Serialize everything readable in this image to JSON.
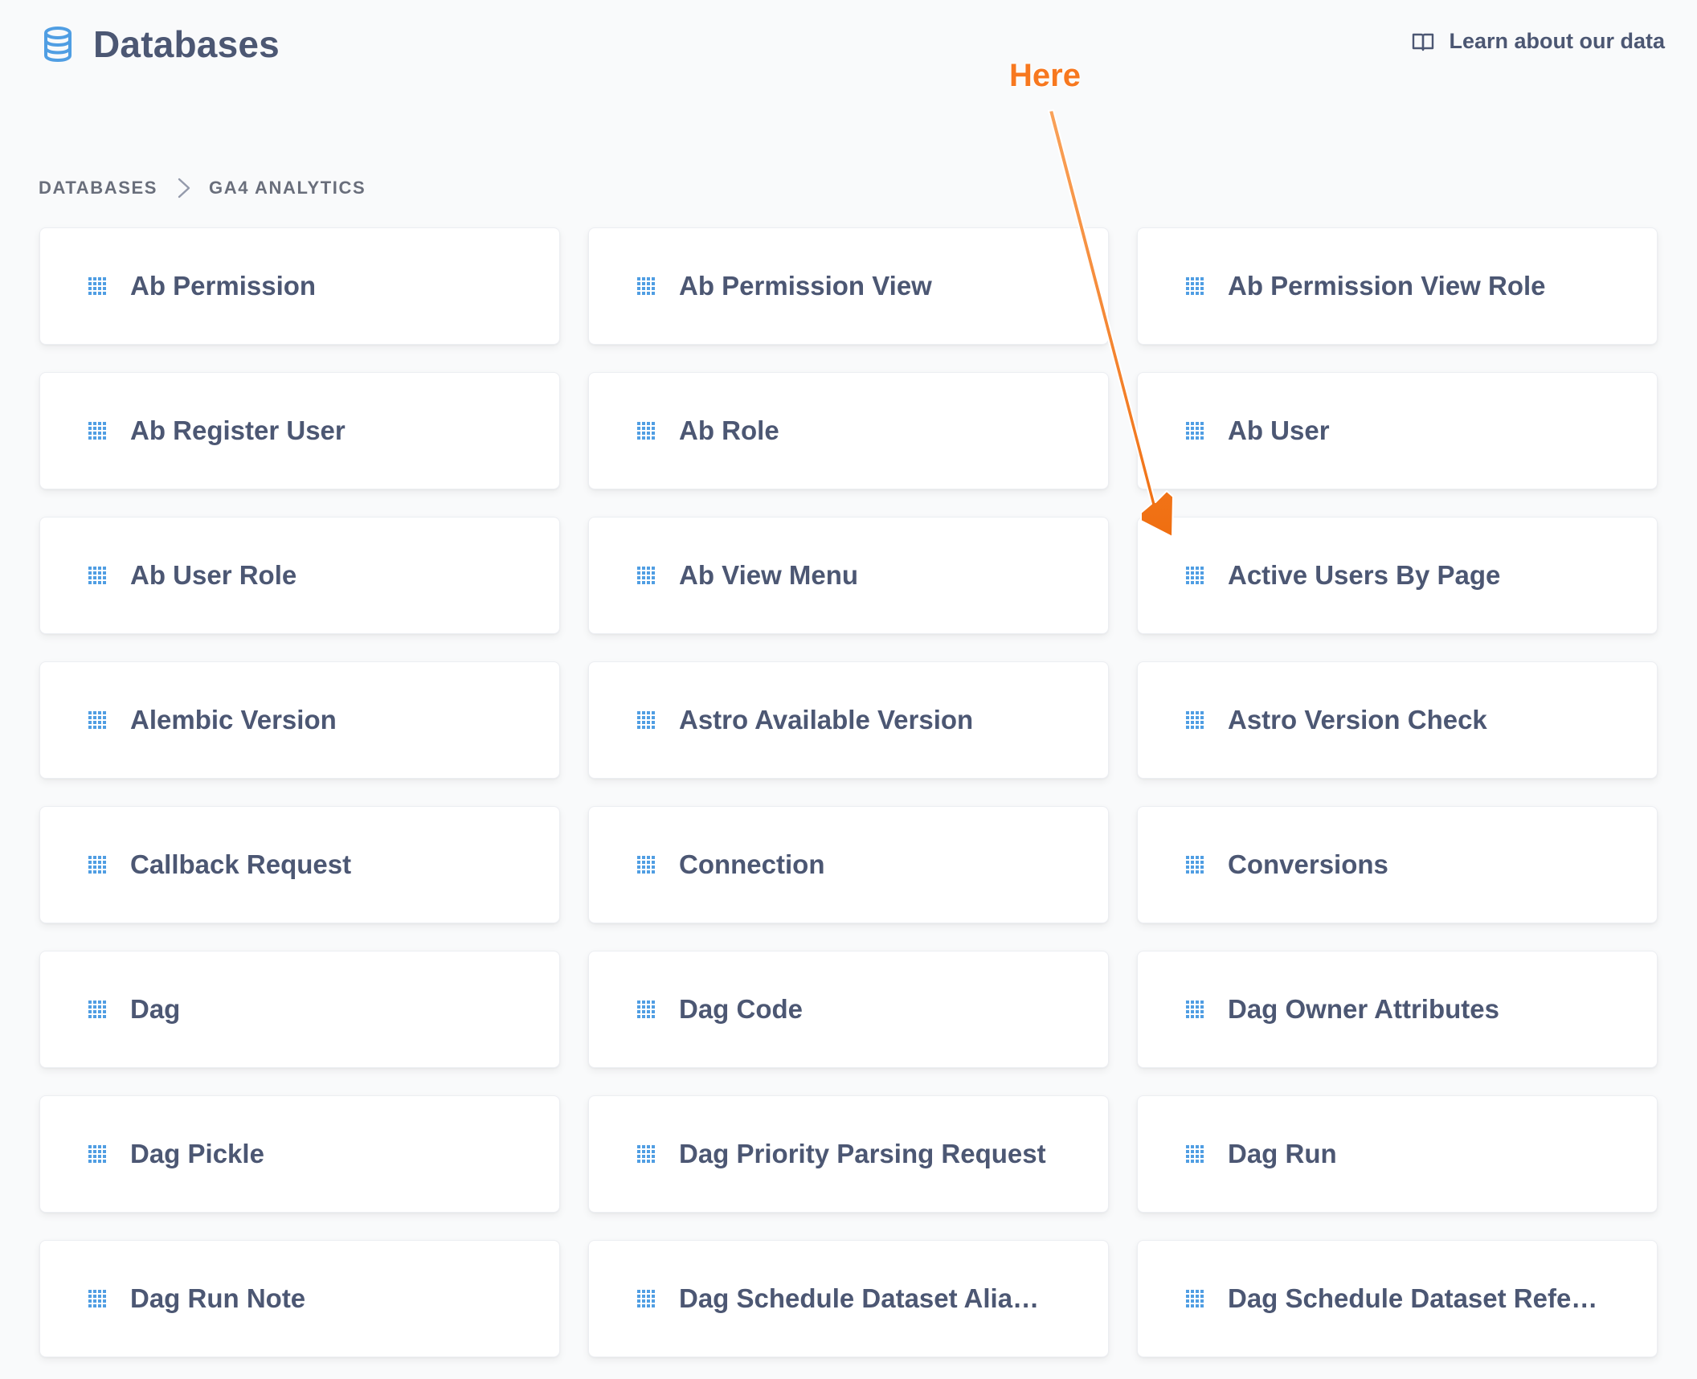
{
  "header": {
    "title": "Databases",
    "icon": "database-icon",
    "learn_link": "Learn about our data",
    "learn_icon": "book-icon"
  },
  "breadcrumb": {
    "items": [
      "DATABASES",
      "GA4 ANALYTICS"
    ],
    "separator_icon": "chevron-right-icon"
  },
  "tables": [
    {
      "label": "Ab Permission"
    },
    {
      "label": "Ab Permission View"
    },
    {
      "label": "Ab Permission View Role"
    },
    {
      "label": "Ab Register User"
    },
    {
      "label": "Ab Role"
    },
    {
      "label": "Ab User"
    },
    {
      "label": "Ab User Role"
    },
    {
      "label": "Ab View Menu"
    },
    {
      "label": "Active Users By Page"
    },
    {
      "label": "Alembic Version"
    },
    {
      "label": "Astro Available Version"
    },
    {
      "label": "Astro Version Check"
    },
    {
      "label": "Callback Request"
    },
    {
      "label": "Connection"
    },
    {
      "label": "Conversions"
    },
    {
      "label": "Dag"
    },
    {
      "label": "Dag Code"
    },
    {
      "label": "Dag Owner Attributes"
    },
    {
      "label": "Dag Pickle"
    },
    {
      "label": "Dag Priority Parsing Request"
    },
    {
      "label": "Dag Run"
    },
    {
      "label": "Dag Run Note"
    },
    {
      "label": "Dag Schedule Dataset Alia…"
    },
    {
      "label": "Dag Schedule Dataset Refe…"
    }
  ],
  "annotation": {
    "text": "Here",
    "color": "#f7781f"
  },
  "colors": {
    "accent": "#509ee3",
    "text": "#4c5773",
    "background": "#f9fafb"
  }
}
